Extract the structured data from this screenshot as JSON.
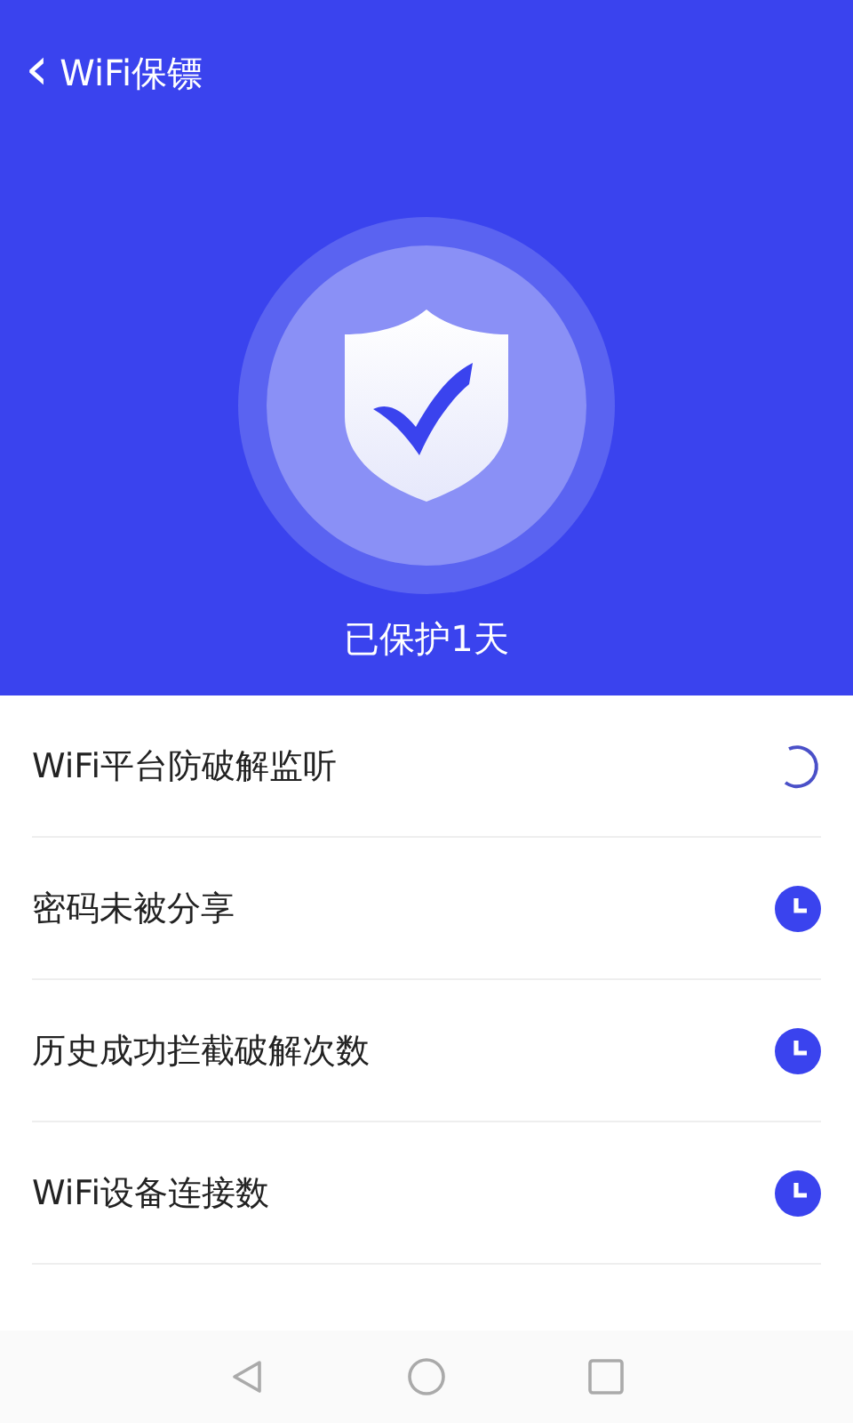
{
  "header": {
    "back_icon": "‹",
    "title": "WiFi保镖",
    "status": "已保护1天"
  },
  "items": [
    {
      "label": "WiFi平台防破解监听",
      "kind": "loading"
    },
    {
      "label": "密码未被分享",
      "kind": "pending"
    },
    {
      "label": "历史成功拦截破解次数",
      "kind": "pending"
    },
    {
      "label": "WiFi设备连接数",
      "kind": "pending"
    }
  ]
}
